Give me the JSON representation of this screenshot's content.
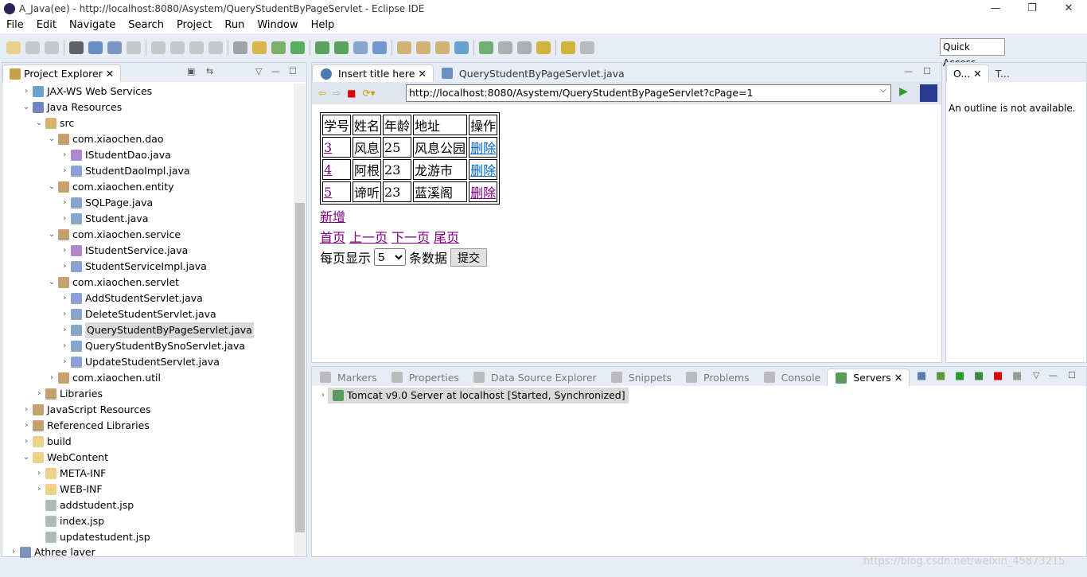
{
  "window": {
    "title": "A_Java(ee) - http://localhost:8080/Asystem/QueryStudentByPageServlet - Eclipse IDE",
    "minimize": "—",
    "restore": "❐",
    "close": "✕"
  },
  "menu": [
    "File",
    "Edit",
    "Navigate",
    "Search",
    "Project",
    "Run",
    "Window",
    "Help"
  ],
  "quick_access": "Quick Access",
  "project_explorer": {
    "title": "Project Explorer",
    "items": [
      {
        "level": 1,
        "arrow": "collapsed",
        "icon": "web-services-icon",
        "label": "JAX-WS Web Services"
      },
      {
        "level": 1,
        "arrow": "expanded",
        "icon": "java-resources-icon",
        "label": "Java Resources"
      },
      {
        "level": 2,
        "arrow": "expanded",
        "icon": "source-folder-icon",
        "label": "src"
      },
      {
        "level": 3,
        "arrow": "expanded",
        "icon": "package-icon",
        "label": "com.xiaochen.dao"
      },
      {
        "level": 4,
        "arrow": "collapsed",
        "icon": "java-interface-icon",
        "label": "IStudentDao.java"
      },
      {
        "level": 4,
        "arrow": "collapsed",
        "icon": "java-file-icon",
        "label": "StudentDaoImpl.java"
      },
      {
        "level": 3,
        "arrow": "expanded",
        "icon": "package-icon",
        "label": "com.xiaochen.entity"
      },
      {
        "level": 4,
        "arrow": "collapsed",
        "icon": "java-file-icon",
        "label": "SQLPage.java"
      },
      {
        "level": 4,
        "arrow": "collapsed",
        "icon": "java-file-icon",
        "label": "Student.java"
      },
      {
        "level": 3,
        "arrow": "expanded",
        "icon": "package-icon",
        "label": "com.xiaochen.service"
      },
      {
        "level": 4,
        "arrow": "collapsed",
        "icon": "java-interface-icon",
        "label": "IStudentService.java"
      },
      {
        "level": 4,
        "arrow": "collapsed",
        "icon": "java-file-icon",
        "label": "StudentServiceImpl.java"
      },
      {
        "level": 3,
        "arrow": "expanded",
        "icon": "package-icon",
        "label": "com.xiaochen.servlet"
      },
      {
        "level": 4,
        "arrow": "collapsed",
        "icon": "java-file-icon",
        "label": "AddStudentServlet.java"
      },
      {
        "level": 4,
        "arrow": "collapsed",
        "icon": "java-file-icon",
        "label": "DeleteStudentServlet.java"
      },
      {
        "level": 4,
        "arrow": "collapsed",
        "icon": "java-file-icon",
        "label": "QueryStudentByPageServlet.java",
        "selected": true
      },
      {
        "level": 4,
        "arrow": "collapsed",
        "icon": "java-file-icon",
        "label": "QueryStudentBySnoServlet.java"
      },
      {
        "level": 4,
        "arrow": "collapsed",
        "icon": "java-file-icon",
        "label": "UpdateStudentServlet.java"
      },
      {
        "level": 3,
        "arrow": "collapsed",
        "icon": "package-icon",
        "label": "com.xiaochen.util"
      },
      {
        "level": 2,
        "arrow": "collapsed",
        "icon": "library-icon",
        "label": "Libraries"
      },
      {
        "level": 1,
        "arrow": "collapsed",
        "icon": "library-icon",
        "label": "JavaScript Resources"
      },
      {
        "level": 1,
        "arrow": "collapsed",
        "icon": "library-icon",
        "label": "Referenced Libraries"
      },
      {
        "level": 1,
        "arrow": "collapsed",
        "icon": "folder-icon",
        "label": "build"
      },
      {
        "level": 1,
        "arrow": "expanded",
        "icon": "folder-icon",
        "label": "WebContent"
      },
      {
        "level": 2,
        "arrow": "collapsed",
        "icon": "folder-icon",
        "label": "META-INF"
      },
      {
        "level": 2,
        "arrow": "collapsed",
        "icon": "folder-icon",
        "label": "WEB-INF"
      },
      {
        "level": 2,
        "arrow": "none",
        "icon": "jsp-file-icon",
        "label": "addstudent.jsp"
      },
      {
        "level": 2,
        "arrow": "none",
        "icon": "jsp-file-icon",
        "label": "index.jsp"
      },
      {
        "level": 2,
        "arrow": "none",
        "icon": "jsp-file-icon",
        "label": "updatestudent.jsp"
      },
      {
        "level": 0,
        "arrow": "collapsed",
        "icon": "project-icon",
        "label": "Athree laver"
      }
    ]
  },
  "editor": {
    "tabs": [
      {
        "label": "Insert title here",
        "active": true
      },
      {
        "label": "QueryStudentByPageServlet.java",
        "active": false
      }
    ],
    "url": "http://localhost:8080/Asystem/QueryStudentByPageServlet?cPage=1",
    "table": {
      "headers": [
        "学号",
        "姓名",
        "年龄",
        "地址",
        "操作"
      ],
      "rows": [
        [
          "3",
          "风息",
          "25",
          "风息公园",
          "删除"
        ],
        [
          "4",
          "阿根",
          "23",
          "龙游市",
          "删除"
        ],
        [
          "5",
          "谛听",
          "23",
          "蓝溪阁",
          "删除"
        ]
      ]
    },
    "add_link": "新增",
    "pager": [
      "首页",
      "上一页",
      "下一页",
      "尾页"
    ],
    "page_size_label": "每页显示",
    "page_size_value": "5",
    "page_size_suffix": "条数据",
    "submit": "提交"
  },
  "outline": {
    "tabs": [
      "O...",
      "T..."
    ],
    "message": "An outline is not available."
  },
  "bottom": {
    "tabs": [
      "Markers",
      "Properties",
      "Data Source Explorer",
      "Snippets",
      "Problems",
      "Console",
      "Servers"
    ],
    "active": "Servers",
    "server": "Tomcat v9.0 Server at localhost  [Started, Synchronized]"
  },
  "watermark": "https://blog.csdn.net/weixin_45873215"
}
